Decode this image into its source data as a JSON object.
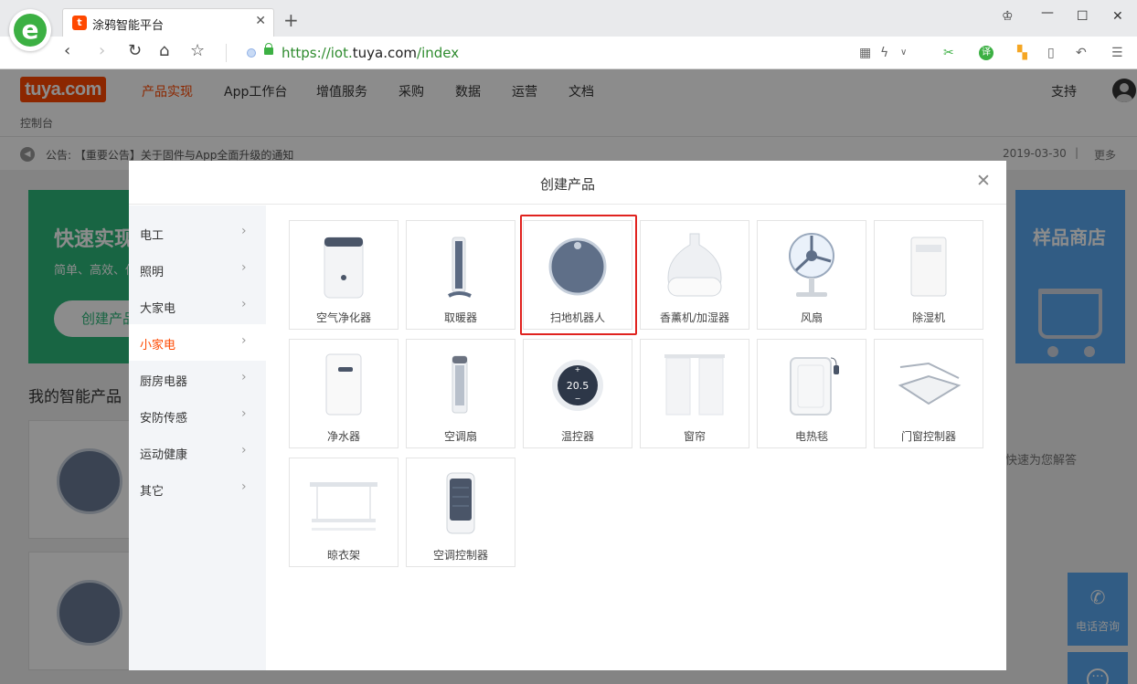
{
  "browser": {
    "tab_title": "涂鸦智能平台",
    "tab_favicon": "t",
    "logo_glyph": "e",
    "url_scheme": "https://iot.",
    "url_domain": "tuya.com",
    "url_path": "/index",
    "icons": {
      "browser_logo": "360-browser-e-icon",
      "back": "back-arrow-icon",
      "forward": "forward-arrow-icon",
      "reload": "reload-icon",
      "home": "home-icon",
      "bookmark": "star-icon"
    }
  },
  "site": {
    "logo_text": "tuya.com",
    "nav": [
      "产品实现",
      "App工作台",
      "增值服务",
      "采购",
      "数据",
      "运营",
      "文档"
    ],
    "active_nav": "产品实现",
    "support": "支持",
    "breadcrumb": "控制台",
    "notice_label": "公告:",
    "notice_text": "【重要公告】关于固件与App全面升级的通知",
    "notice_date": "2019-03-30",
    "notice_sep": "|",
    "notice_more": "更多",
    "banner_left_title": "快速实现",
    "banner_left_sub": "简单、高效、低",
    "banner_left_btn": "创建产品",
    "banner_right_title": "样品商店",
    "my_products": "我的智能产品",
    "hint_text": "快速为您解答",
    "call_label": "电话咨询",
    "accent_color": "#ff4800"
  },
  "modal": {
    "title": "创建产品",
    "categories": [
      {
        "label": "电工"
      },
      {
        "label": "照明"
      },
      {
        "label": "大家电"
      },
      {
        "label": "小家电"
      },
      {
        "label": "厨房电器"
      },
      {
        "label": "安防传感"
      },
      {
        "label": "运动健康"
      },
      {
        "label": "其它"
      }
    ],
    "active_category": "小家电",
    "products": [
      {
        "name": "空气净化器",
        "icon": "air-purifier-icon"
      },
      {
        "name": "取暖器",
        "icon": "heater-icon"
      },
      {
        "name": "扫地机器人",
        "icon": "robot-vacuum-icon",
        "highlighted": true
      },
      {
        "name": "香薰机/加湿器",
        "icon": "humidifier-icon"
      },
      {
        "name": "风扇",
        "icon": "fan-icon"
      },
      {
        "name": "除湿机",
        "icon": "dehumidifier-icon"
      },
      {
        "name": "净水器",
        "icon": "water-purifier-icon"
      },
      {
        "name": "空调扇",
        "icon": "air-cooler-fan-icon"
      },
      {
        "name": "温控器",
        "icon": "thermostat-icon",
        "display": "20.5",
        "plus": "+",
        "minus": "−"
      },
      {
        "name": "窗帘",
        "icon": "curtain-icon"
      },
      {
        "name": "电热毯",
        "icon": "electric-blanket-icon"
      },
      {
        "name": "门窗控制器",
        "icon": "window-controller-icon"
      },
      {
        "name": "晾衣架",
        "icon": "clothes-rack-icon"
      },
      {
        "name": "空调控制器",
        "icon": "ac-controller-icon"
      }
    ]
  }
}
